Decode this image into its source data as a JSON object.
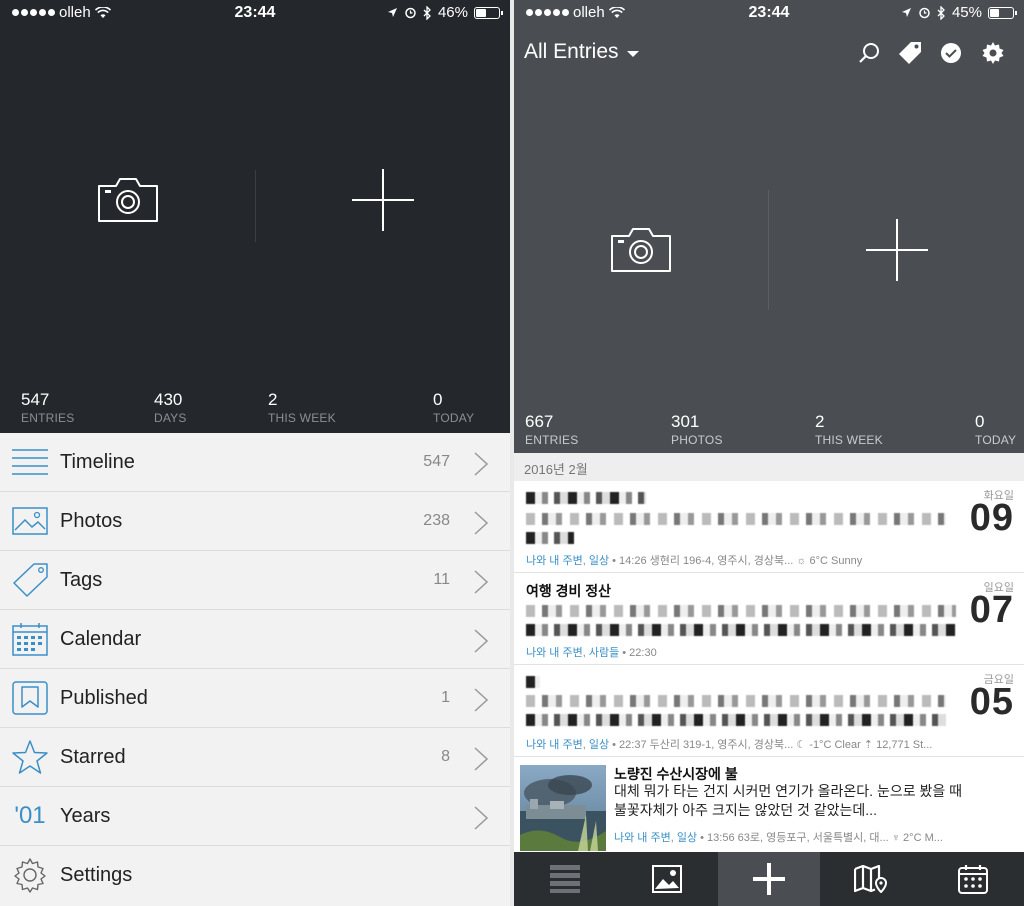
{
  "left": {
    "status": {
      "carrier": "olleh",
      "time": "23:44",
      "battery": "46%",
      "battery_level": 0.46
    },
    "stats": [
      {
        "value": "547",
        "label": "ENTRIES"
      },
      {
        "value": "430",
        "label": "DAYS"
      },
      {
        "value": "2",
        "label": "THIS WEEK"
      },
      {
        "value": "0",
        "label": "TODAY"
      }
    ],
    "menu": [
      {
        "label": "Timeline",
        "count": "547",
        "icon": "timeline-icon"
      },
      {
        "label": "Photos",
        "count": "238",
        "icon": "photos-icon"
      },
      {
        "label": "Tags",
        "count": "11",
        "icon": "tag-icon"
      },
      {
        "label": "Calendar",
        "count": "",
        "icon": "calendar-icon"
      },
      {
        "label": "Published",
        "count": "1",
        "icon": "bookmark-icon"
      },
      {
        "label": "Starred",
        "count": "8",
        "icon": "star-icon"
      },
      {
        "label": "Years",
        "count": "",
        "icon": "years-icon",
        "glyph": "'01"
      },
      {
        "label": "Settings",
        "count": "",
        "icon": "gear-icon"
      }
    ]
  },
  "right": {
    "status": {
      "carrier": "olleh",
      "time": "23:44",
      "battery": "45%",
      "battery_level": 0.45
    },
    "header": {
      "title": "All Entries"
    },
    "stats": [
      {
        "value": "667",
        "label": "ENTRIES"
      },
      {
        "value": "301",
        "label": "PHOTOS"
      },
      {
        "value": "2",
        "label": "THIS WEEK"
      },
      {
        "value": "0",
        "label": "TODAY"
      }
    ],
    "section": "2016년 2월",
    "entries": [
      {
        "title": "",
        "journal": "나와 내 주변",
        "tag": "일상",
        "meta": " • 14:26 생현리 196-4, 영주시, 경상북... ☼ 6°C Sunny",
        "dow": "화요일",
        "day": "09"
      },
      {
        "title": "여행 경비 정산",
        "journal": "나와 내 주변",
        "tag": "사람들",
        "meta": " • 22:30",
        "dow": "일요일",
        "day": "07"
      },
      {
        "title": "",
        "journal": "나와 내 주변",
        "tag": "일상",
        "meta": " • 22:37 두산리 319-1, 영주시, 경상북... ☾ -1°C Clear  ⇡ 12,771 St...",
        "dow": "금요일",
        "day": "05"
      },
      {
        "title": "노량진 수산시장에 불",
        "body": "대체 뭐가 타는 건지 시커먼 연기가 올라온다. 눈으로 봤을 때 불꽃자체가 아주 크지는 않았던 것 같았는데...",
        "journal": "나와 내 주변",
        "tag": "일상",
        "meta": " • 13:56 63로, 영등포구, 서울특별시, 대... ♆ 2°C M..."
      }
    ]
  }
}
